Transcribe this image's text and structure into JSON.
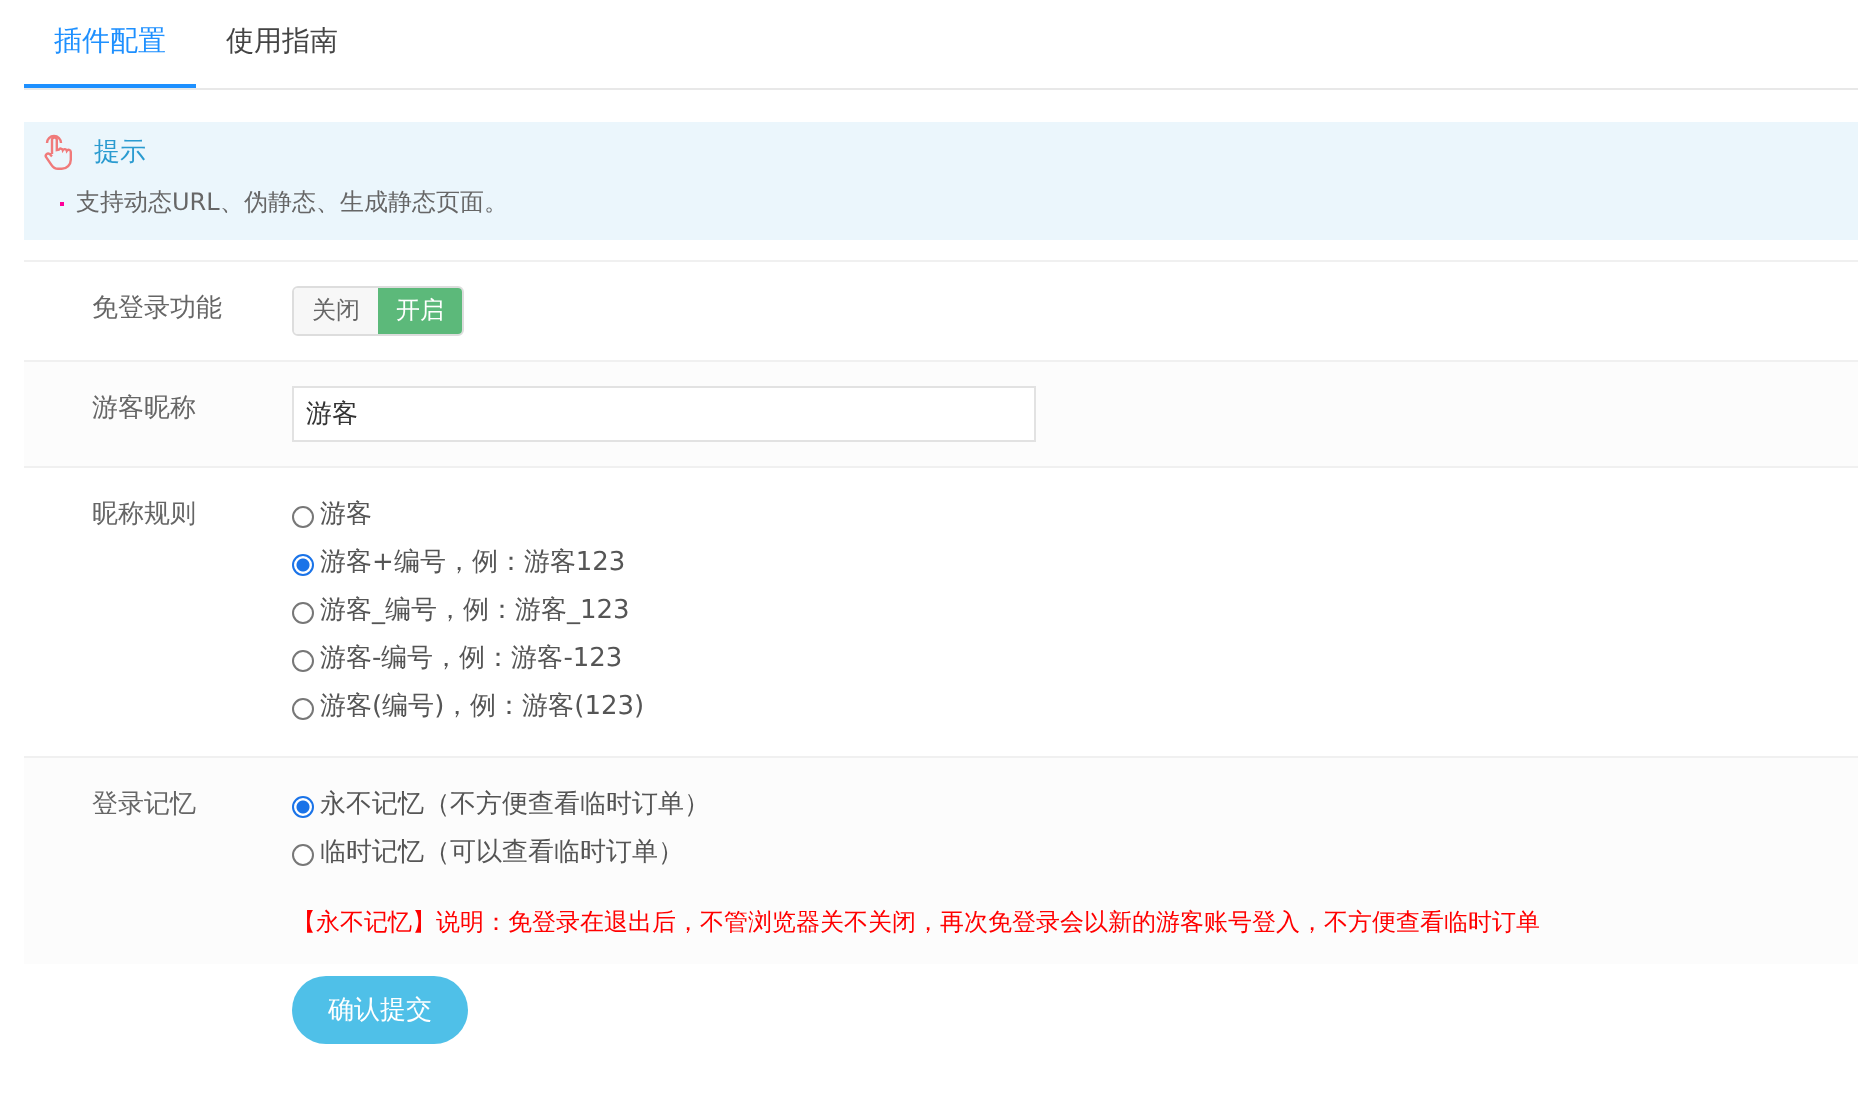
{
  "tabs": [
    {
      "label": "插件配置",
      "selected": true
    },
    {
      "label": "使用指南",
      "selected": false
    }
  ],
  "tip": {
    "title": "提示",
    "items": [
      "支持动态URL、伪静态、生成静态页面。"
    ]
  },
  "form": [
    {
      "kind": "toggle",
      "label": "免登录功能",
      "options": [
        {
          "label": "关闭",
          "selected": false
        },
        {
          "label": "开启",
          "selected": true
        }
      ]
    },
    {
      "kind": "text",
      "label": "游客昵称",
      "value": "游客"
    },
    {
      "kind": "radio",
      "label": "昵称规则",
      "options": [
        {
          "label": "游客",
          "selected": false
        },
        {
          "label": "游客+编号，例：游客123",
          "selected": true
        },
        {
          "label": "游客_编号，例：游客_123",
          "selected": false
        },
        {
          "label": "游客-编号，例：游客-123",
          "selected": false
        },
        {
          "label": "游客(编号)，例：游客(123)",
          "selected": false
        }
      ]
    },
    {
      "kind": "radio",
      "label": "登录记忆",
      "options": [
        {
          "label": "永不记忆（不方便查看临时订单）",
          "selected": true
        },
        {
          "label": "临时记忆（可以查看临时订单）",
          "selected": false
        }
      ],
      "note": "【永不记忆】说明：免登录在退出后，不管浏览器关不关闭，再次免登录会以新的游客账号登入，不方便查看临时订单"
    }
  ],
  "submit": "确认提交"
}
